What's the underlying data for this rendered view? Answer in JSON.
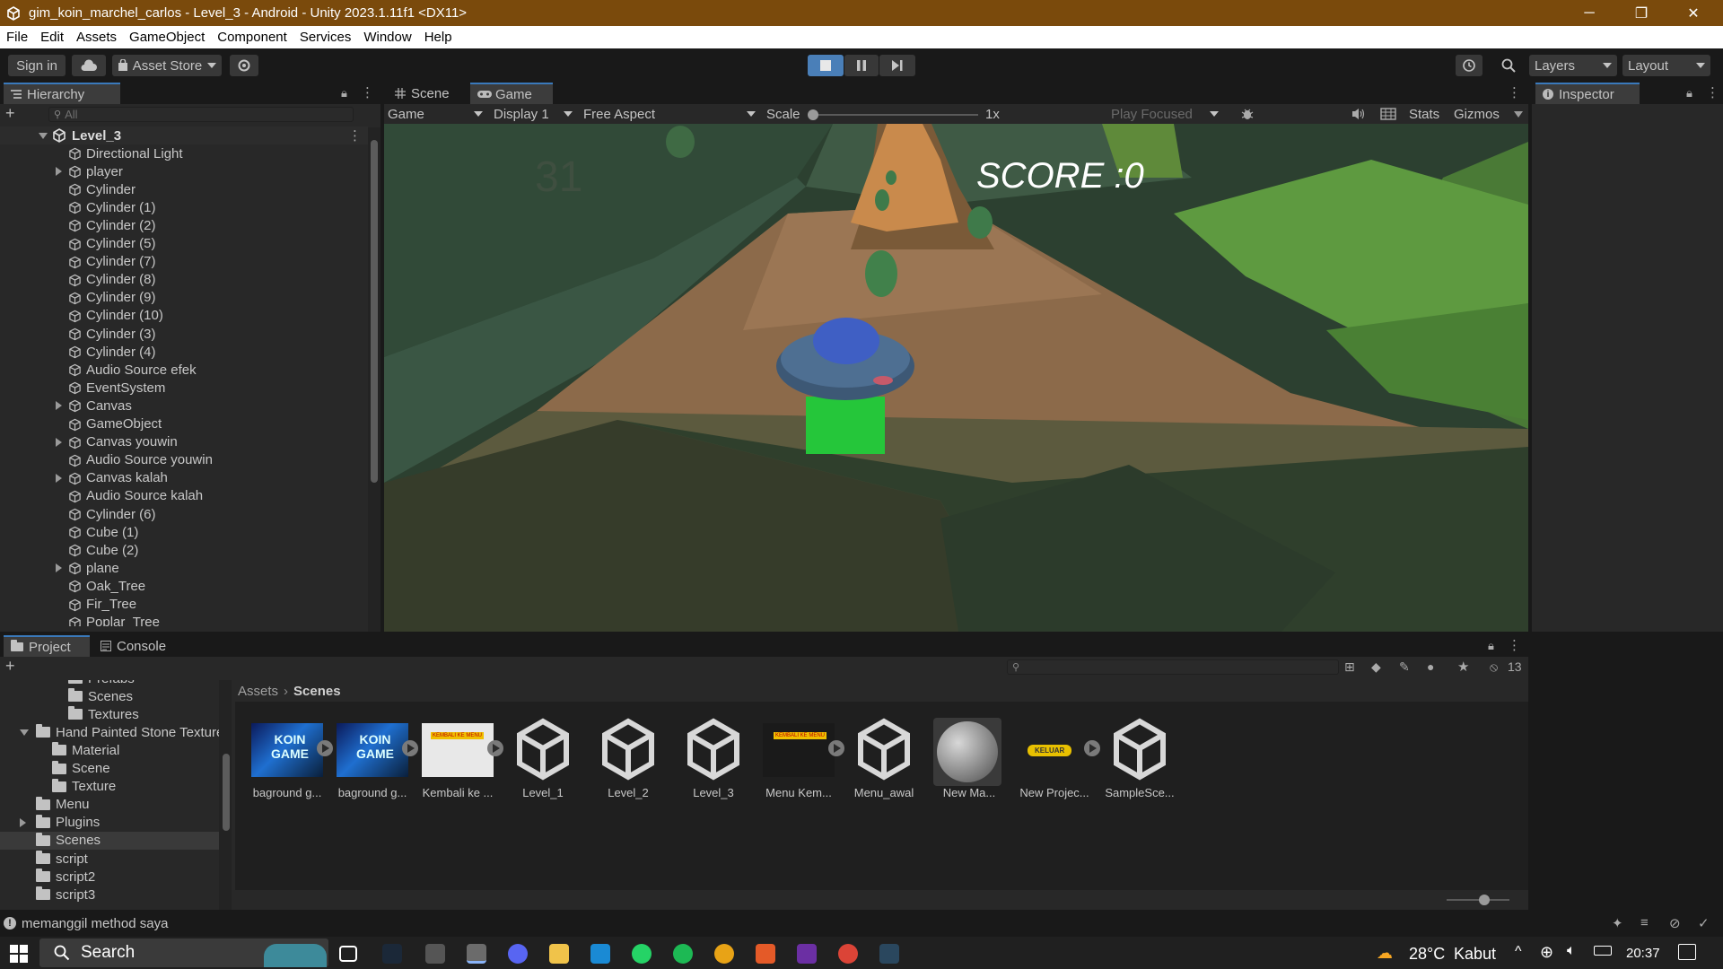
{
  "window": {
    "title": "gim_koin_marchel_carlos - Level_3 - Android - Unity 2023.1.11f1 <DX11>",
    "controls": [
      "─",
      "❐",
      "✕"
    ]
  },
  "menu": [
    "File",
    "Edit",
    "Assets",
    "GameObject",
    "Component",
    "Services",
    "Window",
    "Help"
  ],
  "toolbar": {
    "sign_in": "Sign in",
    "asset_store": "Asset Store",
    "layers": "Layers",
    "layout": "Layout"
  },
  "hierarchy": {
    "tab": "Hierarchy",
    "search_placeholder": "All",
    "scene": "Level_3",
    "items": [
      {
        "label": "Directional Light",
        "expandable": false
      },
      {
        "label": "player",
        "expandable": true
      },
      {
        "label": "Cylinder",
        "expandable": false
      },
      {
        "label": "Cylinder (1)",
        "expandable": false
      },
      {
        "label": "Cylinder (2)",
        "expandable": false
      },
      {
        "label": "Cylinder (5)",
        "expandable": false
      },
      {
        "label": "Cylinder (7)",
        "expandable": false
      },
      {
        "label": "Cylinder (8)",
        "expandable": false
      },
      {
        "label": "Cylinder (9)",
        "expandable": false
      },
      {
        "label": "Cylinder (10)",
        "expandable": false
      },
      {
        "label": "Cylinder (3)",
        "expandable": false
      },
      {
        "label": "Cylinder (4)",
        "expandable": false
      },
      {
        "label": "Audio Source efek",
        "expandable": false
      },
      {
        "label": "EventSystem",
        "expandable": false
      },
      {
        "label": "Canvas",
        "expandable": true
      },
      {
        "label": "GameObject",
        "expandable": false
      },
      {
        "label": "Canvas youwin",
        "expandable": true
      },
      {
        "label": "Audio Source youwin",
        "expandable": false
      },
      {
        "label": "Canvas kalah",
        "expandable": true
      },
      {
        "label": "Audio Source kalah",
        "expandable": false
      },
      {
        "label": "Cylinder (6)",
        "expandable": false
      },
      {
        "label": "Cube (1)",
        "expandable": false
      },
      {
        "label": "Cube (2)",
        "expandable": false
      },
      {
        "label": "plane",
        "expandable": true
      },
      {
        "label": "Oak_Tree",
        "expandable": false
      },
      {
        "label": "Fir_Tree",
        "expandable": false
      },
      {
        "label": "Poplar_Tree",
        "expandable": false
      }
    ]
  },
  "game_view": {
    "tabs": [
      "Scene",
      "Game"
    ],
    "active_tab": "Game",
    "mode": "Game",
    "display": "Display 1",
    "aspect": "Free Aspect",
    "scale_label": "Scale",
    "scale_value": "1x",
    "play_focused": "Play Focused",
    "stats": "Stats",
    "gizmos": "Gizmos",
    "hud_timer": "31",
    "hud_score": "SCORE :0"
  },
  "inspector": {
    "tab": "Inspector"
  },
  "project": {
    "tabs": [
      "Project",
      "Console"
    ],
    "breadcrumb": [
      "Assets",
      "Scenes"
    ],
    "hidden_count": "13",
    "folders": [
      {
        "label": "Prefabs",
        "indent": 3
      },
      {
        "label": "Scenes",
        "indent": 3
      },
      {
        "label": "Textures",
        "indent": 3
      },
      {
        "label": "Hand Painted Stone Texture",
        "indent": 1,
        "expanded": true
      },
      {
        "label": "Material",
        "indent": 2
      },
      {
        "label": "Scene",
        "indent": 2
      },
      {
        "label": "Texture",
        "indent": 2
      },
      {
        "label": "Menu",
        "indent": 1
      },
      {
        "label": "Plugins",
        "indent": 1,
        "collapsed": true
      },
      {
        "label": "Scenes",
        "indent": 1,
        "selected": true
      },
      {
        "label": "script",
        "indent": 1
      },
      {
        "label": "script2",
        "indent": 1
      },
      {
        "label": "script3",
        "indent": 1
      }
    ],
    "assets": [
      {
        "label": "baground g...",
        "kind": "video"
      },
      {
        "label": "baground g...",
        "kind": "video"
      },
      {
        "label": "Kembali ke ...",
        "kind": "button"
      },
      {
        "label": "Level_1",
        "kind": "unity"
      },
      {
        "label": "Level_2",
        "kind": "unity"
      },
      {
        "label": "Level_3",
        "kind": "unity"
      },
      {
        "label": "Menu Kem...",
        "kind": "dark"
      },
      {
        "label": "Menu_awal",
        "kind": "unity"
      },
      {
        "label": "New Ma...",
        "kind": "material"
      },
      {
        "label": "New Projec...",
        "kind": "keluar"
      },
      {
        "label": "SampleSce...",
        "kind": "unity"
      }
    ],
    "thumb_texts": {
      "video": "KOIN GAME",
      "button": "KEMBALI KE MENU",
      "keluar": "KELUAR"
    }
  },
  "status": {
    "message": "memanggil method saya"
  },
  "taskbar": {
    "search": "Search",
    "weather_temp": "28°C",
    "weather_text": "Kabut",
    "time": "20:37"
  },
  "colors": {
    "accent": "#3a79bb",
    "title_bar": "#7a4a0c",
    "panel": "#282828",
    "taskbar": "#202020",
    "score": "#ffffff"
  }
}
